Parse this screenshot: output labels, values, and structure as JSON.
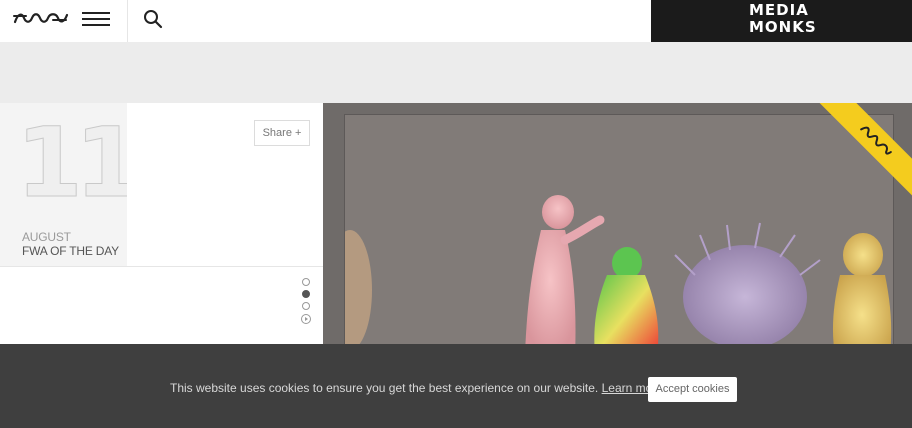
{
  "header": {
    "logo_text": "FWA",
    "sponsor_line1": "MEDIA",
    "sponsor_line2": "MONKS"
  },
  "feature": {
    "day": "11",
    "month": "AUGUST",
    "label": "FWA OF THE DAY",
    "share_label": "Share +",
    "ribbon_logo": "FWA"
  },
  "carousel": {
    "slides_total": 3,
    "active_index": 1
  },
  "cookie": {
    "message": "This website uses cookies to ensure you get the best experience on our website.",
    "learn_more": "Learn more",
    "accept_label": "Accept cookies"
  }
}
